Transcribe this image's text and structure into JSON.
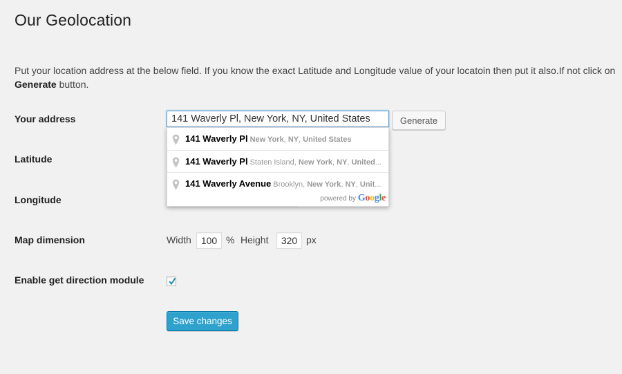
{
  "page": {
    "title": "Our Geolocation",
    "intro_text": "Put your location address at the below field. If you know the exact Latitude and Longitude value of your locatoin then put it also.If not click on",
    "intro_bold": "Generate",
    "intro_tail": " button."
  },
  "form": {
    "address_label": "Your address",
    "address_value": "141 Waverly Pl, New York, NY, United States",
    "generate_label": "Generate",
    "latitude_label": "Latitude",
    "longitude_label": "Longitude",
    "map_dimension_label": "Map dimension",
    "width_label": "Width",
    "width_value": "100",
    "width_unit": "%",
    "height_label": "Height",
    "height_value": "320",
    "height_unit": "px",
    "direction_label": "Enable get direction module",
    "direction_checked": true,
    "save_label": "Save changes"
  },
  "autocomplete": {
    "items": [
      {
        "main": "141 Waverly Pl",
        "pre": "",
        "parts": [
          "New York",
          ", ",
          "NY",
          ", ",
          "United States"
        ],
        "tail": ""
      },
      {
        "main": "141 Waverly Pl",
        "pre": "Staten Island, ",
        "parts": [
          "New York",
          ", ",
          "NY",
          ", ",
          "United"
        ],
        "tail": "..."
      },
      {
        "main": "141 Waverly Avenue",
        "pre": "Brooklyn, ",
        "parts": [
          "New York",
          ", ",
          "NY",
          ", ",
          "Unit"
        ],
        "tail": "..."
      }
    ],
    "powered_by": "powered by",
    "google": "Google"
  },
  "colors": {
    "primary_button": "#2ea2cc",
    "focus_border": "#5b9dd9",
    "background": "#f1f1f1"
  }
}
